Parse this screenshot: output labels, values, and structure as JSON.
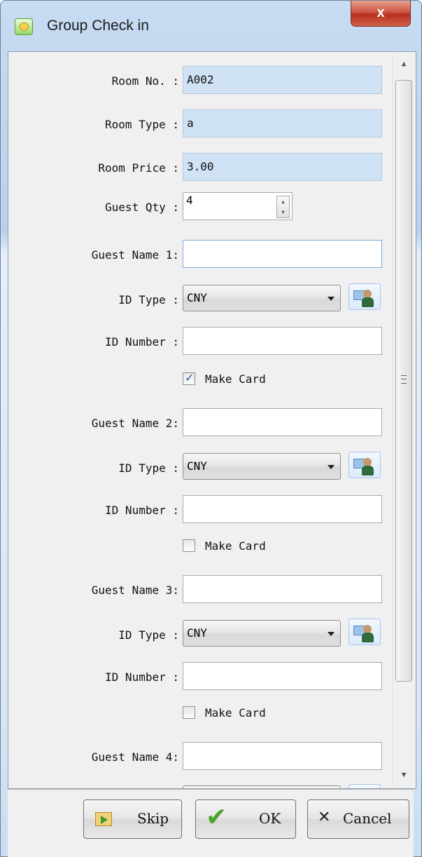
{
  "window": {
    "title": "Group Check in",
    "close_label": "x"
  },
  "fields": {
    "room_no": {
      "label": "Room No. :",
      "value": "A002"
    },
    "room_type": {
      "label": "Room Type :",
      "value": "a"
    },
    "room_price": {
      "label": "Room Price :",
      "value": "3.00"
    },
    "guest_qty": {
      "label": "Guest Qty :",
      "value": "4"
    }
  },
  "guests": [
    {
      "name_label": "Guest Name 1:",
      "name_value": "",
      "id_type_label": "ID Type :",
      "id_type_value": "CNY",
      "id_number_label": "ID Number :",
      "id_number_value": "",
      "make_card_label": "Make Card",
      "make_card_checked": true
    },
    {
      "name_label": "Guest Name 2:",
      "name_value": "",
      "id_type_label": "ID Type :",
      "id_type_value": "CNY",
      "id_number_label": "ID Number :",
      "id_number_value": "",
      "make_card_label": "Make Card",
      "make_card_checked": false
    },
    {
      "name_label": "Guest Name 3:",
      "name_value": "",
      "id_type_label": "ID Type :",
      "id_type_value": "CNY",
      "id_number_label": "ID Number :",
      "id_number_value": "",
      "make_card_label": "Make Card",
      "make_card_checked": false
    },
    {
      "name_label": "Guest Name 4:",
      "name_value": ""
    }
  ],
  "icons": {
    "id_reader": "id-card-reader-icon",
    "skip": "skip-icon",
    "ok": "checkmark-icon",
    "cancel": "x-icon"
  },
  "buttons": {
    "skip": "Skip",
    "ok": "OK",
    "cancel": "Cancel"
  }
}
